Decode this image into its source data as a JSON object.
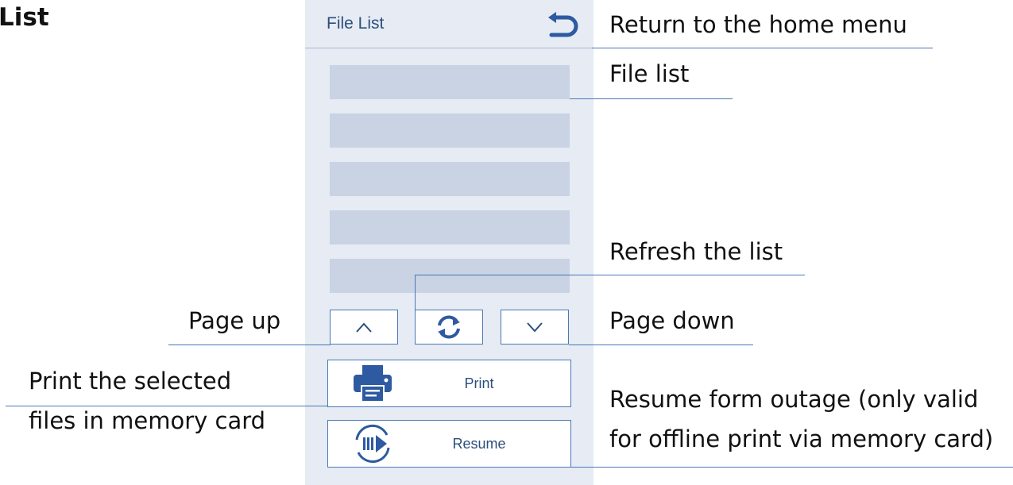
{
  "heading": "List",
  "screen": {
    "title": "File List",
    "file_rows": [
      "",
      "",
      "",
      "",
      ""
    ],
    "buttons": {
      "page_up_icon": "chevron-up-icon",
      "refresh_icon": "refresh-icon",
      "page_down_icon": "chevron-down-icon",
      "print_label": "Print",
      "resume_label": "Resume"
    }
  },
  "annotations": {
    "return_home": "Return to the home menu",
    "file_list": "File list",
    "refresh": "Refresh the list",
    "page_up": "Page up",
    "page_down": "Page down",
    "print_line1": "Print the selected",
    "print_line2": "files in memory card",
    "resume_line1": "Resume form outage (only valid",
    "resume_line2": "for offline print via memory card)"
  },
  "colors": {
    "panel_bg": "#e6ebf4",
    "row_bg": "#c9d3e4",
    "accent": "#2d5aa0",
    "line": "#4a79b6"
  }
}
